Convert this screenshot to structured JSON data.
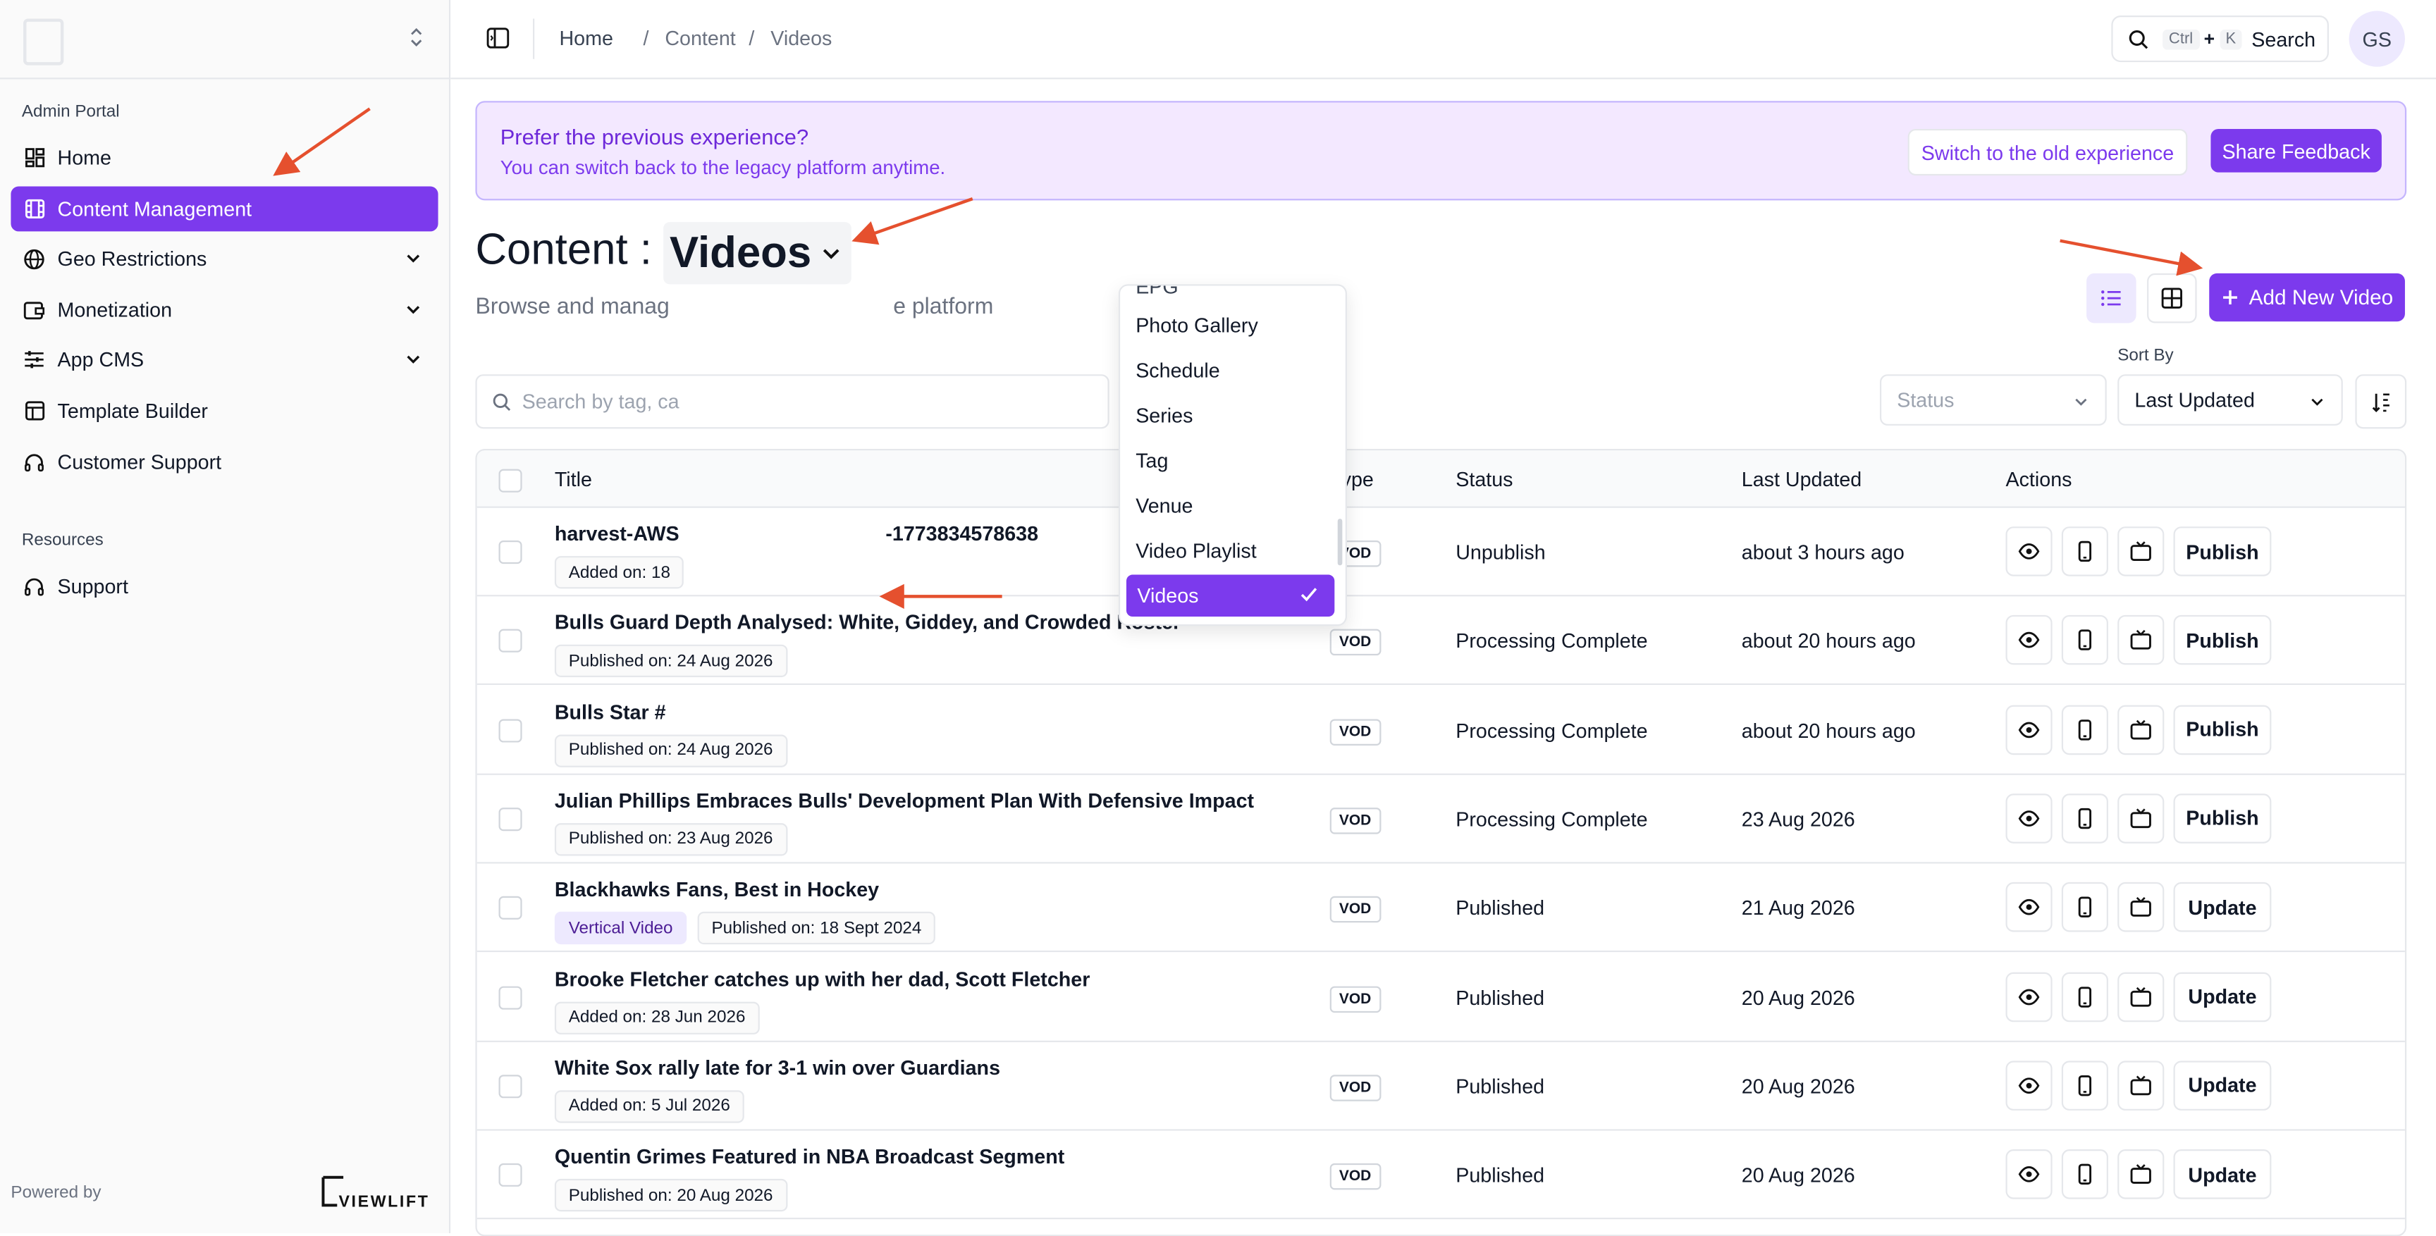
{
  "sidebar": {
    "section_admin": "Admin Portal",
    "items": [
      {
        "label": "Home",
        "icon": "grid-icon"
      },
      {
        "label": "Content Management",
        "icon": "film-icon"
      },
      {
        "label": "Geo Restrictions",
        "icon": "globe-icon"
      },
      {
        "label": "Monetization",
        "icon": "wallet-icon"
      },
      {
        "label": "App CMS",
        "icon": "sliders-icon"
      },
      {
        "label": "Template Builder",
        "icon": "layout-icon"
      },
      {
        "label": "Customer Support",
        "icon": "headset-icon"
      }
    ],
    "section_resources": "Resources",
    "resources": [
      {
        "label": "Support",
        "icon": "headset-icon"
      }
    ],
    "powered_by": "Powered by",
    "brand": "VIEWLIFT"
  },
  "topbar": {
    "breadcrumb": [
      "Home",
      "Content",
      "Videos"
    ],
    "search_label": "Search",
    "kbd_ctrl": "Ctrl",
    "kbd_plus": "+",
    "kbd_k": "K",
    "avatar": "GS"
  },
  "banner": {
    "title": "Prefer the previous experience?",
    "subtitle": "You can switch back to the legacy platform anytime.",
    "switch_label": "Switch to the old experience",
    "feedback_label": "Share Feedback"
  },
  "header": {
    "title_prefix": "Content :",
    "type_selected": "Videos",
    "description_start": "Browse and manag",
    "description_end": "e platform",
    "add_label": "Add New Video"
  },
  "toolbar": {
    "search_placeholder": "Search by tag, ca",
    "status_placeholder": "Status",
    "sort_by_label": "Sort By",
    "sort_value": "Last Updated"
  },
  "dropdown": {
    "partial_top": "EPG",
    "items": [
      "Photo Gallery",
      "Schedule",
      "Series",
      "Tag",
      "Venue",
      "Video Playlist"
    ],
    "selected": "Videos"
  },
  "table": {
    "headers": {
      "title": "Title",
      "type": "Type",
      "status": "Status",
      "updated": "Last Updated",
      "actions": "Actions"
    },
    "rows": [
      {
        "title": "harvest-AWS",
        "title_tail": "-1773834578638",
        "chips": [
          "Added on: 18"
        ],
        "type": "VOD",
        "status": "Unpublish",
        "updated": "about 3 hours ago",
        "action": "Publish"
      },
      {
        "title": "Bulls Guard Depth Analysed: White, Giddey, and Crowded Roster",
        "chips": [
          "Published on: 24 Aug 2026"
        ],
        "type": "VOD",
        "status": "Processing Complete",
        "updated": "about 20 hours ago",
        "action": "Publish"
      },
      {
        "title": "Bulls Star #",
        "chips": [
          "Published on: 24 Aug 2026"
        ],
        "type": "VOD",
        "status": "Processing Complete",
        "updated": "about 20 hours ago",
        "action": "Publish"
      },
      {
        "title": "Julian Phillips Embraces Bulls' Development Plan With Defensive Impact",
        "chips": [
          "Published on: 23 Aug 2026"
        ],
        "type": "VOD",
        "status": "Processing Complete",
        "updated": "23 Aug 2026",
        "action": "Publish"
      },
      {
        "title": "Blackhawks Fans, Best in Hockey",
        "chips": [
          "Vertical Video",
          "Published on: 18 Sept 2024"
        ],
        "type": "VOD",
        "status": "Published",
        "updated": "21 Aug 2026",
        "action": "Update"
      },
      {
        "title": "Brooke Fletcher catches up with her dad, Scott Fletcher",
        "chips": [
          "Added on: 28 Jun 2026"
        ],
        "type": "VOD",
        "status": "Published",
        "updated": "20 Aug 2026",
        "action": "Update"
      },
      {
        "title": "White Sox rally late for 3-1 win over Guardians",
        "chips": [
          "Added on: 5 Jul 2026"
        ],
        "type": "VOD",
        "status": "Published",
        "updated": "20 Aug 2026",
        "action": "Update"
      },
      {
        "title": "Quentin Grimes Featured in NBA Broadcast Segment",
        "chips": [
          "Published on: 20 Aug 2026"
        ],
        "type": "VOD",
        "status": "Published",
        "updated": "20 Aug 2026",
        "action": "Update"
      }
    ]
  },
  "colors": {
    "accent": "#7c3aed",
    "annotation_arrow": "#e5502e"
  }
}
